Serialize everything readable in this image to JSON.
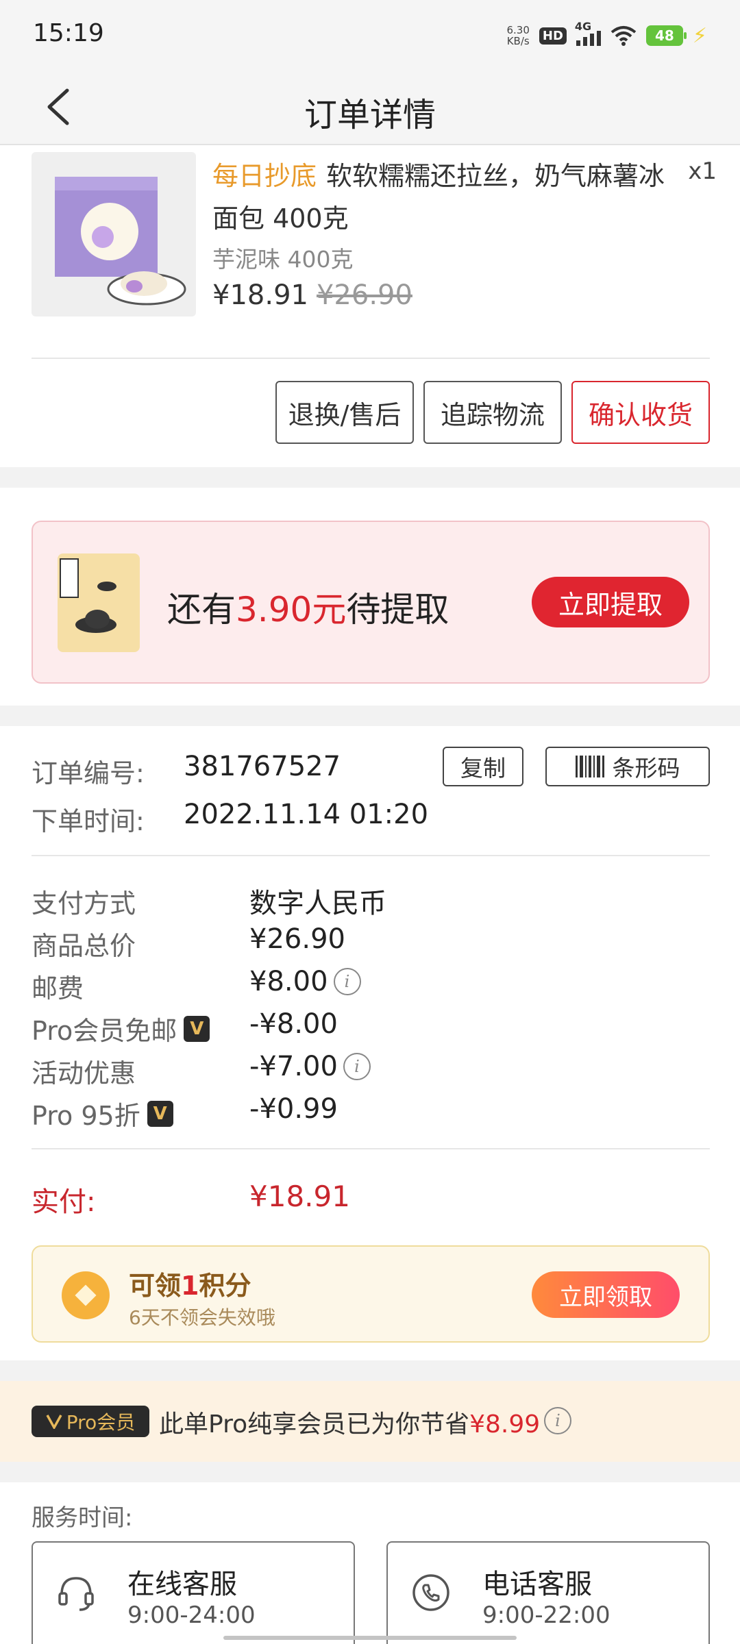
{
  "status_bar": {
    "time": "15:19",
    "net_speed_value": "6.30",
    "net_speed_unit": "KB/s",
    "hd": "HD",
    "network": "4G",
    "battery": "48"
  },
  "nav": {
    "title": "订单详情",
    "back_icon": "chevron-left-icon"
  },
  "product": {
    "tag": "每日抄底",
    "name": "软软糯糯还拉丝，奶气麻薯冰面包 400克",
    "quantity": "x1",
    "variant": "芋泥味 400克",
    "price": "¥18.91",
    "original_price": "¥26.90"
  },
  "actions": {
    "return": "退换/售后",
    "track": "追踪物流",
    "confirm": "确认收货"
  },
  "extract": {
    "prefix": "还有",
    "amount": "3.90元",
    "suffix": "待提取",
    "button": "立即提取"
  },
  "order": {
    "number_label": "订单编号:",
    "number": "381767527",
    "copy": "复制",
    "barcode": "条形码",
    "time_label": "下单时间:",
    "time": "2022.11.14 01:20"
  },
  "payment": {
    "rows": [
      {
        "label": "支付方式",
        "value": "数字人民币"
      },
      {
        "label": "商品总价",
        "value": "¥26.90"
      },
      {
        "label": "邮费",
        "value": "¥8.00"
      },
      {
        "label": "Pro会员免邮",
        "value": "-¥8.00"
      },
      {
        "label": "活动优惠",
        "value": "-¥7.00"
      },
      {
        "label": "Pro 95折",
        "value": "-¥0.99"
      }
    ],
    "paid_label": "实付:",
    "paid_value": "¥18.91"
  },
  "points": {
    "prefix": "可领",
    "num": "1",
    "suffix": "积分",
    "sub": "6天不领会失效哦",
    "button": "立即领取"
  },
  "pro": {
    "tag": "Pro会员",
    "text": "此单Pro纯享会员已为你节省",
    "saved": "¥8.99"
  },
  "service": {
    "label": "服务时间:",
    "online_title": "在线客服",
    "online_hours": "9:00-24:00",
    "phone_title": "电话客服",
    "phone_hours": "9:00-22:00"
  },
  "colors": {
    "accent_red": "#d9262e",
    "tag_orange": "#e89a2b",
    "gold": "#e6b85a",
    "battery_green": "#64c33c"
  }
}
